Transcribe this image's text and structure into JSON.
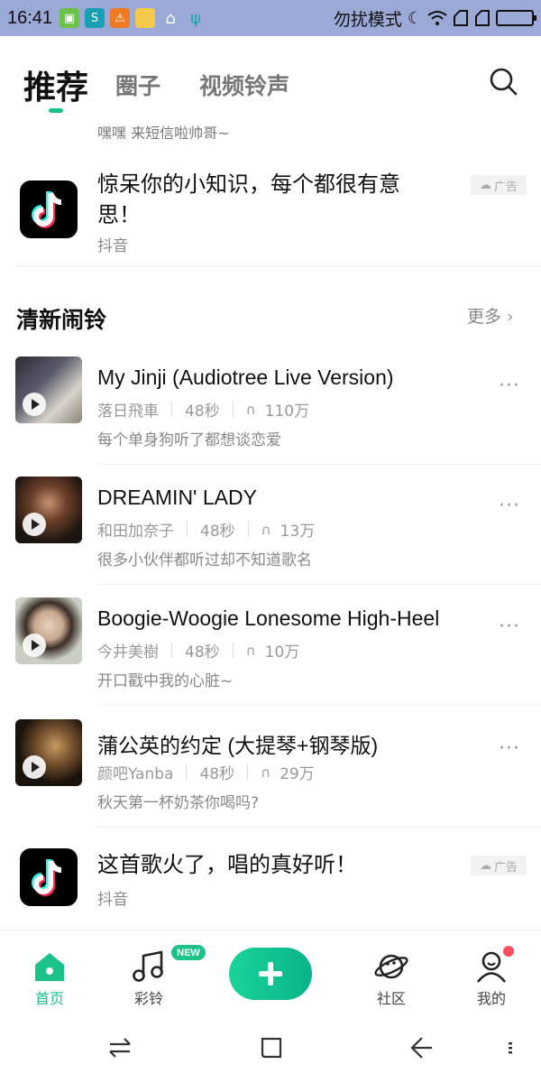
{
  "status_bar": {
    "time": "16:41",
    "dnd_text": "勿扰模式"
  },
  "top_tabs": {
    "recommend": "推荐",
    "circle": "圈子",
    "video_ringtone": "视频铃声"
  },
  "clipped_text": "嘿嘿 来短信啦帅哥~",
  "ad1": {
    "title": "惊呆你的小知识，每个都很有意思！",
    "source": "抖音",
    "badge": "广告"
  },
  "section": {
    "title": "清新闹铃",
    "more": "更多"
  },
  "songs": [
    {
      "title": "My Jinji (Audiotree Live Version)",
      "artist": "落日飛車",
      "duration": "48秒",
      "plays": "110万",
      "desc": "每个单身狗听了都想谈恋爱"
    },
    {
      "title": "DREAMIN' LADY",
      "artist": "和田加奈子",
      "duration": "48秒",
      "plays": "13万",
      "desc": "很多小伙伴都听过却不知道歌名"
    },
    {
      "title": "Boogie-Woogie Lonesome High-Heel",
      "artist": "今井美樹",
      "duration": "48秒",
      "plays": "10万",
      "desc": "开口戳中我的心脏~"
    },
    {
      "title": "蒲公英的约定 (大提琴+钢琴版)",
      "artist": "颜吧Yanba",
      "duration": "48秒",
      "plays": "29万",
      "desc": "秋天第一杯奶茶你喝吗?"
    }
  ],
  "ad2": {
    "title": "这首歌火了，唱的真好听！",
    "source": "抖音",
    "badge": "广告"
  },
  "bottom_nav": {
    "home": "首页",
    "ringtone": "彩铃",
    "new_badge": "NEW",
    "community": "社区",
    "mine": "我的"
  },
  "colors": {
    "accent": "#1cc389",
    "status_bar": "#9aa9d6",
    "notification_dot": "#ff4d5f"
  }
}
